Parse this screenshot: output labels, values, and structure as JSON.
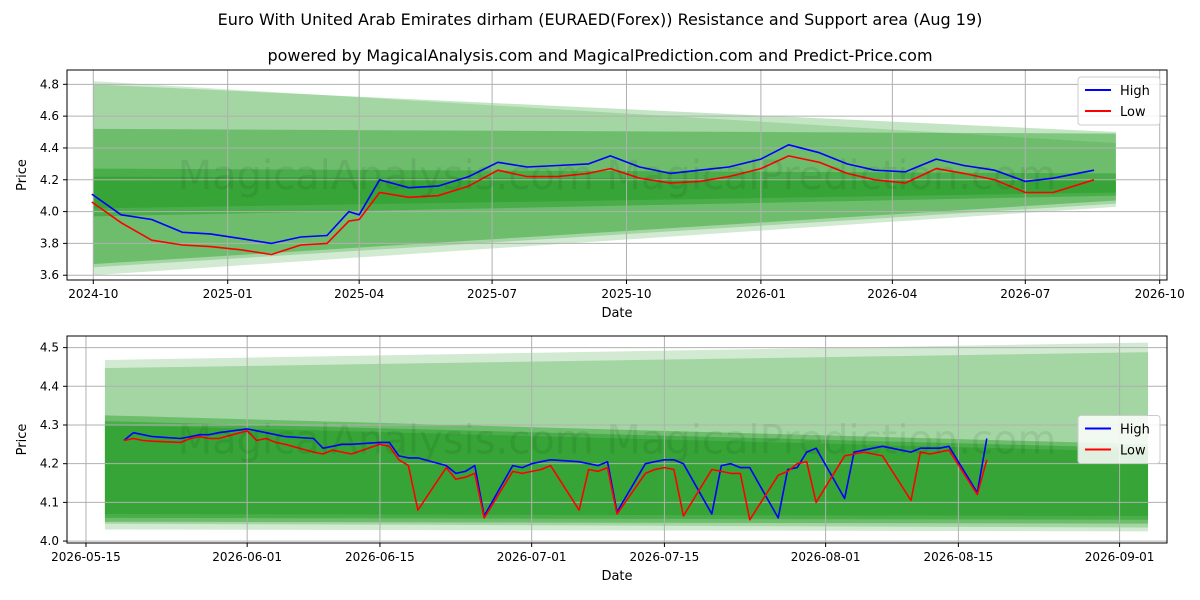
{
  "title": "Euro With United Arab Emirates dirham (EURAED(Forex)) Resistance and Support area (Aug 19)",
  "subtitle": "powered by MagicalAnalysis.com and MagicalPrediction.com and Predict-Price.com",
  "watermark": "MagicalAnalysis.com    MagicalPrediction.com",
  "colors": {
    "high": "#0000ff",
    "low": "#ff0000",
    "band": "#2ca02c",
    "grid": "#b0b0b0"
  },
  "chart_data": [
    {
      "type": "line",
      "xlabel": "Date",
      "ylabel": "Price",
      "xlim": [
        "2024-09-13",
        "2026-10-06"
      ],
      "ylim": [
        3.57,
        4.89
      ],
      "xticks": [
        "2024-10-01",
        "2025-01-01",
        "2025-04-01",
        "2025-07-01",
        "2025-10-01",
        "2026-01-01",
        "2026-04-01",
        "2026-07-01",
        "2026-10-01"
      ],
      "xtick_labels": [
        "2024-10",
        "2025-01",
        "2025-04",
        "2025-07",
        "2025-10",
        "2026-01",
        "2026-04",
        "2026-07",
        "2026-10"
      ],
      "yticks": [
        3.6,
        3.8,
        4.0,
        4.2,
        4.4,
        4.6,
        4.8
      ],
      "ytick_labels": [
        "3.6",
        "3.8",
        "4.0",
        "4.2",
        "4.4",
        "4.6",
        "4.8"
      ],
      "grid": true,
      "legend": "top-right",
      "series": [
        {
          "name": "High",
          "x": [
            "2024-09-30",
            "2024-10-20",
            "2024-11-10",
            "2024-12-01",
            "2024-12-20",
            "2025-01-10",
            "2025-01-31",
            "2025-02-20",
            "2025-03-10",
            "2025-03-25",
            "2025-04-01",
            "2025-04-15",
            "2025-05-05",
            "2025-05-25",
            "2025-06-15",
            "2025-07-05",
            "2025-07-25",
            "2025-08-15",
            "2025-09-05",
            "2025-09-20",
            "2025-10-10",
            "2025-10-31",
            "2025-11-20",
            "2025-12-10",
            "2026-01-01",
            "2026-01-20",
            "2026-02-10",
            "2026-03-01",
            "2026-03-20",
            "2026-04-10",
            "2026-05-01",
            "2026-05-20",
            "2026-06-10",
            "2026-07-01",
            "2026-07-20",
            "2026-08-17"
          ],
          "values": [
            4.11,
            3.98,
            3.95,
            3.87,
            3.86,
            3.83,
            3.8,
            3.84,
            3.85,
            4.0,
            3.98,
            4.2,
            4.15,
            4.16,
            4.22,
            4.31,
            4.28,
            4.29,
            4.3,
            4.35,
            4.28,
            4.24,
            4.26,
            4.28,
            4.33,
            4.42,
            4.37,
            4.3,
            4.26,
            4.25,
            4.33,
            4.29,
            4.26,
            4.19,
            4.21,
            4.26
          ]
        },
        {
          "name": "Low",
          "x": [
            "2024-09-30",
            "2024-10-20",
            "2024-11-10",
            "2024-12-01",
            "2024-12-20",
            "2025-01-10",
            "2025-01-31",
            "2025-02-20",
            "2025-03-10",
            "2025-03-25",
            "2025-04-01",
            "2025-04-15",
            "2025-05-05",
            "2025-05-25",
            "2025-06-15",
            "2025-07-05",
            "2025-07-25",
            "2025-08-15",
            "2025-09-05",
            "2025-09-20",
            "2025-10-10",
            "2025-10-31",
            "2025-11-20",
            "2025-12-10",
            "2026-01-01",
            "2026-01-20",
            "2026-02-10",
            "2026-03-01",
            "2026-03-20",
            "2026-04-10",
            "2026-05-01",
            "2026-05-20",
            "2026-06-10",
            "2026-07-01",
            "2026-07-20",
            "2026-08-17"
          ],
          "values": [
            4.06,
            3.93,
            3.82,
            3.79,
            3.78,
            3.76,
            3.73,
            3.79,
            3.8,
            3.94,
            3.95,
            4.12,
            4.09,
            4.1,
            4.16,
            4.26,
            4.22,
            4.22,
            4.24,
            4.27,
            4.21,
            4.18,
            4.19,
            4.22,
            4.27,
            4.35,
            4.31,
            4.24,
            4.2,
            4.18,
            4.27,
            4.24,
            4.2,
            4.12,
            4.12,
            4.2
          ]
        }
      ],
      "bands": [
        {
          "x": [
            "2024-10-01",
            "2026-09-01"
          ],
          "upper": [
            4.82,
            4.43
          ],
          "lower": [
            3.6,
            4.03
          ]
        },
        {
          "x": [
            "2024-10-01",
            "2026-09-01"
          ],
          "upper": [
            4.8,
            4.5
          ],
          "lower": [
            3.65,
            4.05
          ]
        },
        {
          "x": [
            "2024-10-01",
            "2026-09-01"
          ],
          "upper": [
            4.52,
            4.49
          ],
          "lower": [
            3.67,
            4.07
          ]
        },
        {
          "x": [
            "2024-10-01",
            "2026-09-01"
          ],
          "upper": [
            4.27,
            4.24
          ],
          "lower": [
            3.97,
            4.1
          ]
        },
        {
          "x": [
            "2024-10-01",
            "2026-09-01"
          ],
          "upper": [
            4.22,
            4.2
          ],
          "lower": [
            4.02,
            4.12
          ]
        }
      ]
    },
    {
      "type": "line",
      "xlabel": "Date",
      "ylabel": "Price",
      "xlim": [
        "2026-05-13",
        "2026-09-06"
      ],
      "ylim": [
        3.995,
        4.53
      ],
      "xticks": [
        "2026-05-15",
        "2026-06-01",
        "2026-06-15",
        "2026-07-01",
        "2026-07-15",
        "2026-08-01",
        "2026-08-15",
        "2026-09-01"
      ],
      "xtick_labels": [
        "2026-05-15",
        "2026-06-01",
        "2026-06-15",
        "2026-07-01",
        "2026-07-15",
        "2026-08-01",
        "2026-08-15",
        "2026-09-01"
      ],
      "yticks": [
        4.0,
        4.1,
        4.2,
        4.3,
        4.4,
        4.5
      ],
      "ytick_labels": [
        "4.0",
        "4.1",
        "4.2",
        "4.3",
        "4.4",
        "4.5"
      ],
      "grid": true,
      "legend": "center-right",
      "series": [
        {
          "name": "High",
          "x": [
            "2026-05-19",
            "2026-05-20",
            "2026-05-21",
            "2026-05-22",
            "2026-05-25",
            "2026-05-26",
            "2026-05-27",
            "2026-05-28",
            "2026-05-29",
            "2026-06-01",
            "2026-06-02",
            "2026-06-03",
            "2026-06-04",
            "2026-06-05",
            "2026-06-08",
            "2026-06-09",
            "2026-06-10",
            "2026-06-11",
            "2026-06-12",
            "2026-06-15",
            "2026-06-16",
            "2026-06-17",
            "2026-06-18",
            "2026-06-19",
            "2026-06-22",
            "2026-06-23",
            "2026-06-24",
            "2026-06-25",
            "2026-06-26",
            "2026-06-29",
            "2026-06-30",
            "2026-07-01",
            "2026-07-02",
            "2026-07-03",
            "2026-07-06",
            "2026-07-07",
            "2026-07-08",
            "2026-07-09",
            "2026-07-10",
            "2026-07-13",
            "2026-07-14",
            "2026-07-15",
            "2026-07-16",
            "2026-07-17",
            "2026-07-20",
            "2026-07-21",
            "2026-07-22",
            "2026-07-23",
            "2026-07-24",
            "2026-07-27",
            "2026-07-28",
            "2026-07-29",
            "2026-07-30",
            "2026-07-31",
            "2026-08-03",
            "2026-08-04",
            "2026-08-05",
            "2026-08-06",
            "2026-08-07",
            "2026-08-10",
            "2026-08-11",
            "2026-08-12",
            "2026-08-13",
            "2026-08-14",
            "2026-08-17",
            "2026-08-18"
          ],
          "values": [
            4.26,
            4.28,
            4.275,
            4.27,
            4.265,
            4.27,
            4.275,
            4.275,
            4.28,
            4.29,
            4.285,
            4.28,
            4.275,
            4.27,
            4.265,
            4.24,
            4.245,
            4.25,
            4.25,
            4.255,
            4.255,
            4.22,
            4.215,
            4.215,
            4.195,
            4.175,
            4.18,
            4.195,
            4.065,
            4.195,
            4.19,
            4.2,
            4.205,
            4.21,
            4.205,
            4.2,
            4.195,
            4.205,
            4.075,
            4.2,
            4.205,
            4.21,
            4.21,
            4.2,
            4.07,
            4.195,
            4.2,
            4.19,
            4.19,
            4.06,
            4.185,
            4.19,
            4.23,
            4.24,
            4.11,
            4.23,
            4.235,
            4.24,
            4.245,
            4.23,
            4.24,
            4.24,
            4.24,
            4.245,
            4.125,
            4.265
          ]
        },
        {
          "name": "Low",
          "x": [
            "2026-05-19",
            "2026-05-20",
            "2026-05-21",
            "2026-05-22",
            "2026-05-25",
            "2026-05-26",
            "2026-05-27",
            "2026-05-28",
            "2026-05-29",
            "2026-06-01",
            "2026-06-02",
            "2026-06-03",
            "2026-06-04",
            "2026-06-05",
            "2026-06-08",
            "2026-06-09",
            "2026-06-10",
            "2026-06-11",
            "2026-06-12",
            "2026-06-15",
            "2026-06-16",
            "2026-06-17",
            "2026-06-18",
            "2026-06-19",
            "2026-06-22",
            "2026-06-23",
            "2026-06-24",
            "2026-06-25",
            "2026-06-26",
            "2026-06-29",
            "2026-06-30",
            "2026-07-01",
            "2026-07-02",
            "2026-07-03",
            "2026-07-06",
            "2026-07-07",
            "2026-07-08",
            "2026-07-09",
            "2026-07-10",
            "2026-07-13",
            "2026-07-14",
            "2026-07-15",
            "2026-07-16",
            "2026-07-17",
            "2026-07-20",
            "2026-07-21",
            "2026-07-22",
            "2026-07-23",
            "2026-07-24",
            "2026-07-27",
            "2026-07-28",
            "2026-07-29",
            "2026-07-30",
            "2026-07-31",
            "2026-08-03",
            "2026-08-04",
            "2026-08-05",
            "2026-08-06",
            "2026-08-07",
            "2026-08-10",
            "2026-08-11",
            "2026-08-12",
            "2026-08-13",
            "2026-08-14",
            "2026-08-17",
            "2026-08-18"
          ],
          "values": [
            4.26,
            4.265,
            4.26,
            4.258,
            4.255,
            4.265,
            4.27,
            4.265,
            4.265,
            4.285,
            4.26,
            4.265,
            4.255,
            4.25,
            4.23,
            4.225,
            4.235,
            4.23,
            4.225,
            4.25,
            4.245,
            4.21,
            4.195,
            4.08,
            4.19,
            4.16,
            4.165,
            4.175,
            4.06,
            4.18,
            4.175,
            4.18,
            4.185,
            4.195,
            4.08,
            4.185,
            4.18,
            4.19,
            4.07,
            4.175,
            4.185,
            4.19,
            4.185,
            4.065,
            4.185,
            4.18,
            4.175,
            4.175,
            4.055,
            4.17,
            4.18,
            4.2,
            4.205,
            4.1,
            4.22,
            4.225,
            4.23,
            4.225,
            4.22,
            4.105,
            4.23,
            4.225,
            4.23,
            4.235,
            4.12,
            4.21
          ]
        }
      ],
      "bands": [
        {
          "x": [
            "2026-05-17",
            "2026-09-04"
          ],
          "upper": [
            4.468,
            4.513
          ],
          "lower": [
            4.03,
            4.025
          ]
        },
        {
          "x": [
            "2026-05-17",
            "2026-09-04"
          ],
          "upper": [
            4.447,
            4.488
          ],
          "lower": [
            4.045,
            4.035
          ]
        },
        {
          "x": [
            "2026-05-17",
            "2026-09-04"
          ],
          "upper": [
            4.325,
            4.25
          ],
          "lower": [
            4.05,
            4.045
          ]
        },
        {
          "x": [
            "2026-05-17",
            "2026-09-04"
          ],
          "upper": [
            4.31,
            4.24
          ],
          "lower": [
            4.06,
            4.055
          ]
        },
        {
          "x": [
            "2026-05-17",
            "2026-09-04"
          ],
          "upper": [
            4.3,
            4.23
          ],
          "lower": [
            4.07,
            4.065
          ]
        }
      ]
    }
  ]
}
